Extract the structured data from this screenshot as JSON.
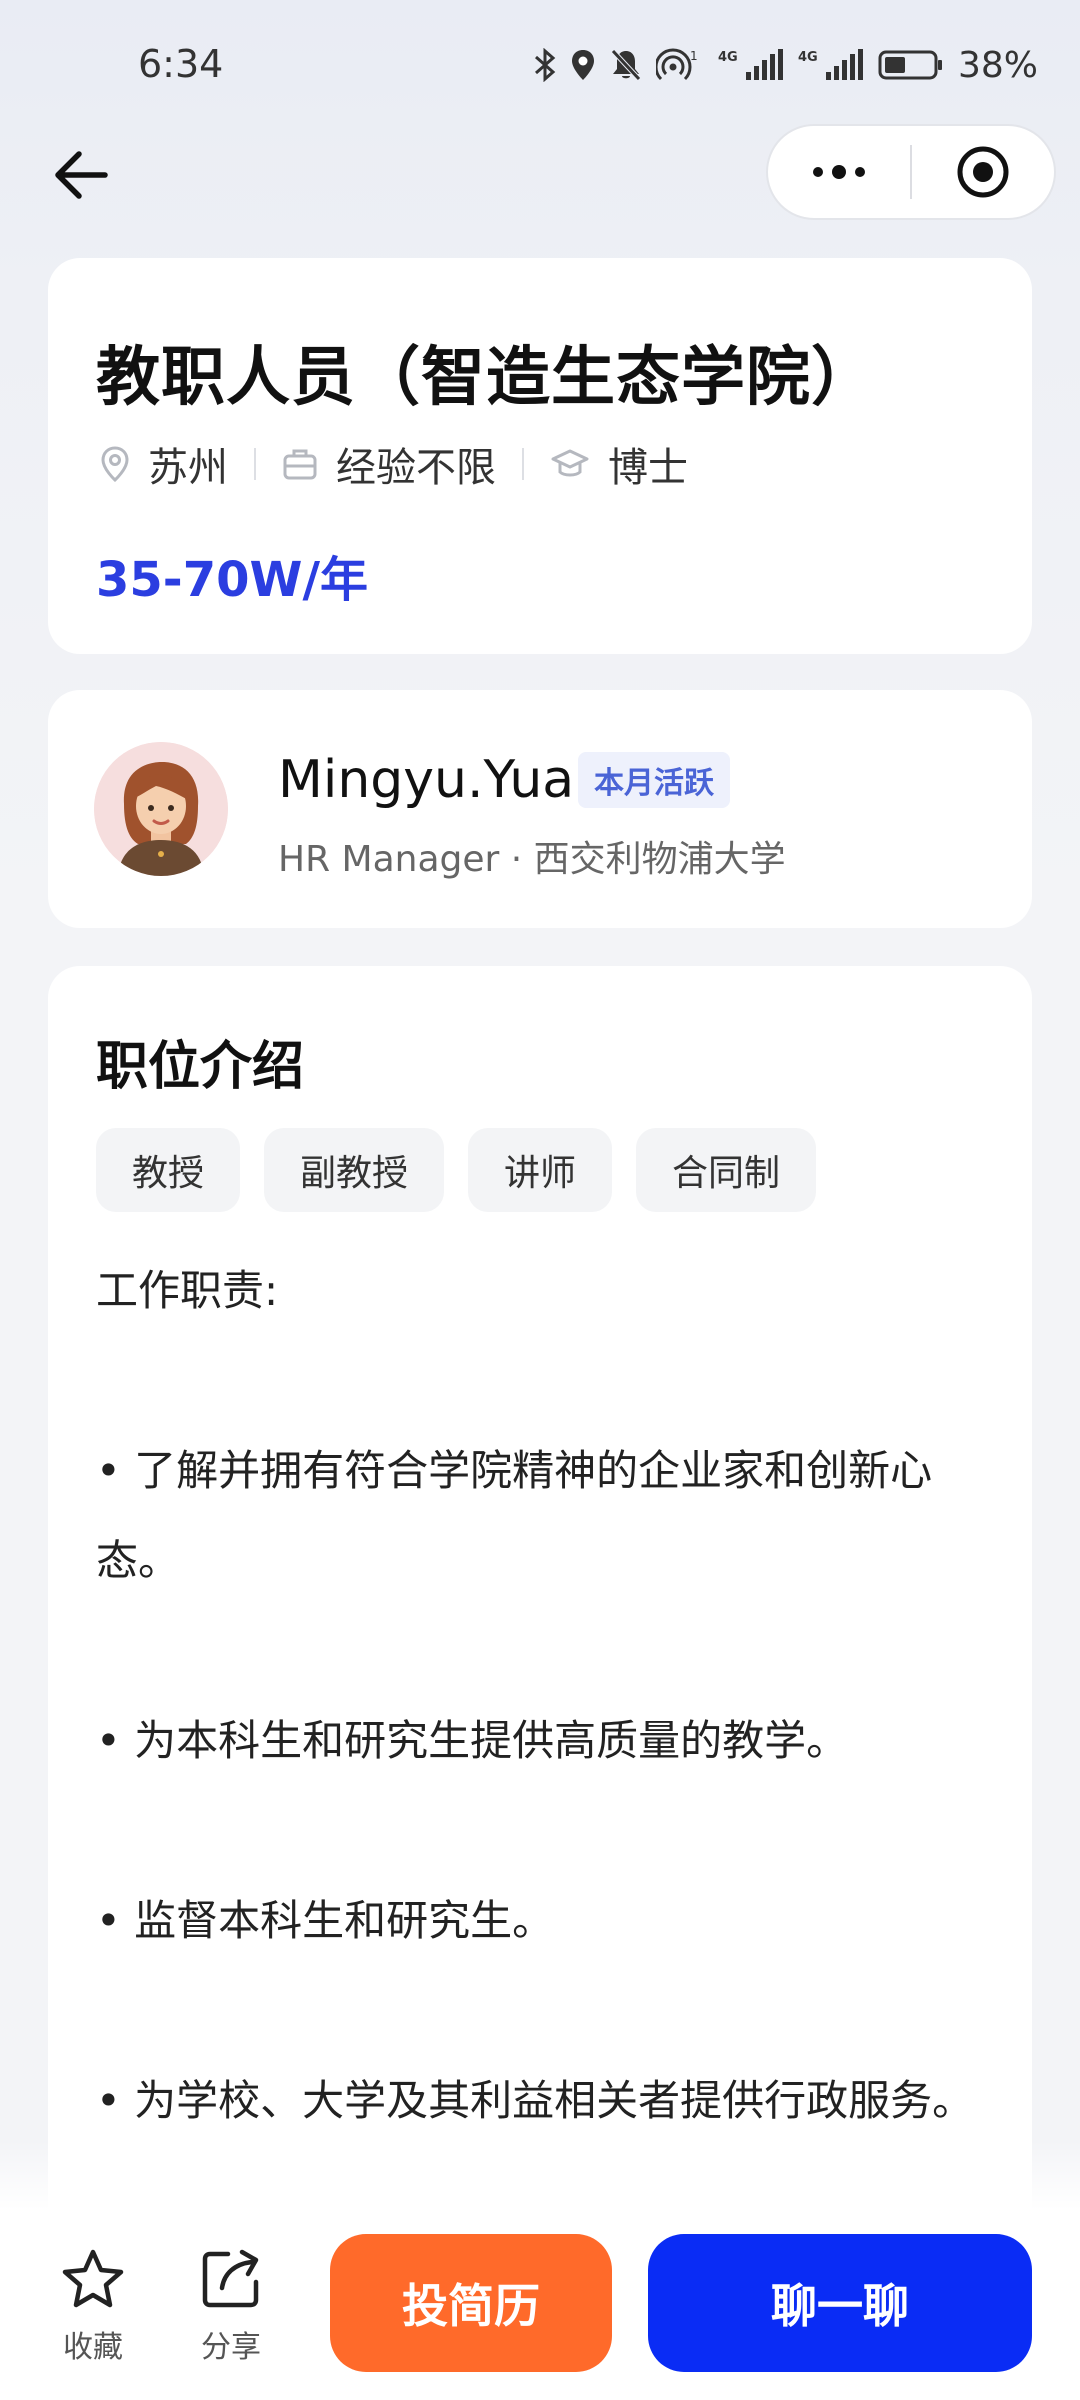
{
  "status_bar": {
    "time": "6:34",
    "battery": "38%",
    "icons": [
      "bluetooth-icon",
      "location-icon",
      "mute-bell-icon",
      "hotspot-icon",
      "signal-4g-icon",
      "signal-4g-icon",
      "battery-icon"
    ]
  },
  "nav": {
    "back_icon": "arrow-left-icon",
    "capsule": [
      "more-icon",
      "target-icon"
    ]
  },
  "job": {
    "title": "教职人员（智造生态学院）",
    "location": "苏州",
    "experience": "经验不限",
    "education": "博士",
    "salary": "35-70W/年"
  },
  "hr": {
    "name": "Mingyu.Yuan",
    "badge": "本月活跃",
    "subtitle": "HR Manager · 西交利物浦大学"
  },
  "description": {
    "heading": "职位介绍",
    "tags": [
      "教授",
      "副教授",
      "讲师",
      "合同制"
    ],
    "paragraphs": [
      "工作职责:",
      "",
      "• 了解并拥有符合学院精神的企业家和创新心态。",
      "",
      "• 为本科生和研究生提供高质量的教学。",
      "",
      "• 监督本科生和研究生。",
      "",
      "• 为学校、大学及其利益相关者提供行政服务。"
    ]
  },
  "bottom_bar": {
    "favorite_label": "收藏",
    "share_label": "分享",
    "apply_label": "投简历",
    "chat_label": "聊一聊"
  },
  "colors": {
    "salary": "#2b3ee0",
    "apply_button": "#ff6a2a",
    "chat_button": "#0a2cf5",
    "badge_text": "#4a64d6"
  }
}
